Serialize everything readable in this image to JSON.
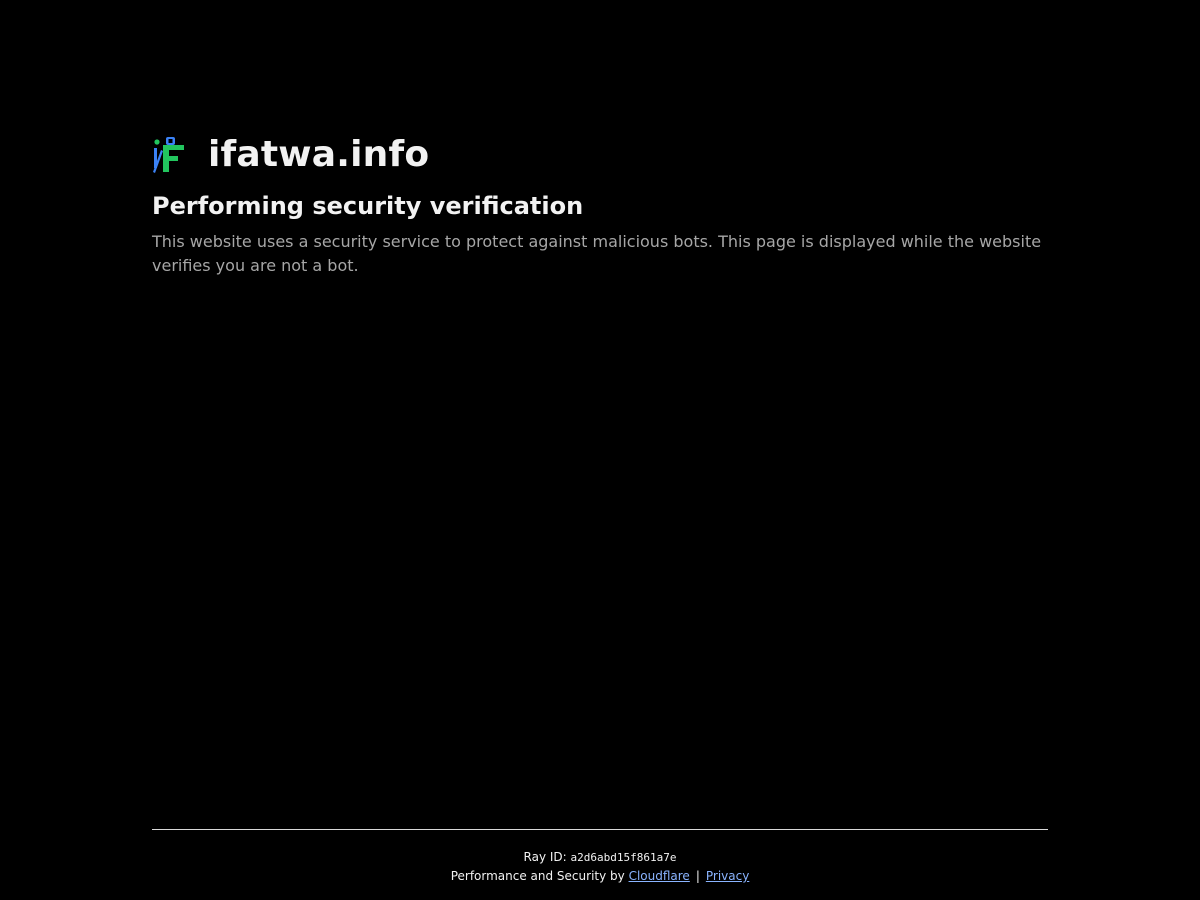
{
  "site": {
    "name": "ifatwa.info",
    "logo_icon": "ifatwa-logo-icon"
  },
  "verification": {
    "heading": "Performing security verification",
    "description": "This website uses a security service to protect against malicious bots. This page is displayed while the website verifies you are not a bot."
  },
  "footer": {
    "ray_label": "Ray ID: ",
    "ray_id": "a2d6abd15f861a7e",
    "performance_text": "Performance and Security by ",
    "cloudflare_link": "Cloudflare",
    "separator": "|",
    "privacy_link": "Privacy"
  },
  "colors": {
    "background": "#000000",
    "text_primary": "#f2f2f2",
    "text_secondary": "#a6a6a6",
    "link": "#8ab4ff",
    "logo_green": "#22c55e",
    "logo_blue": "#3b82f6"
  }
}
